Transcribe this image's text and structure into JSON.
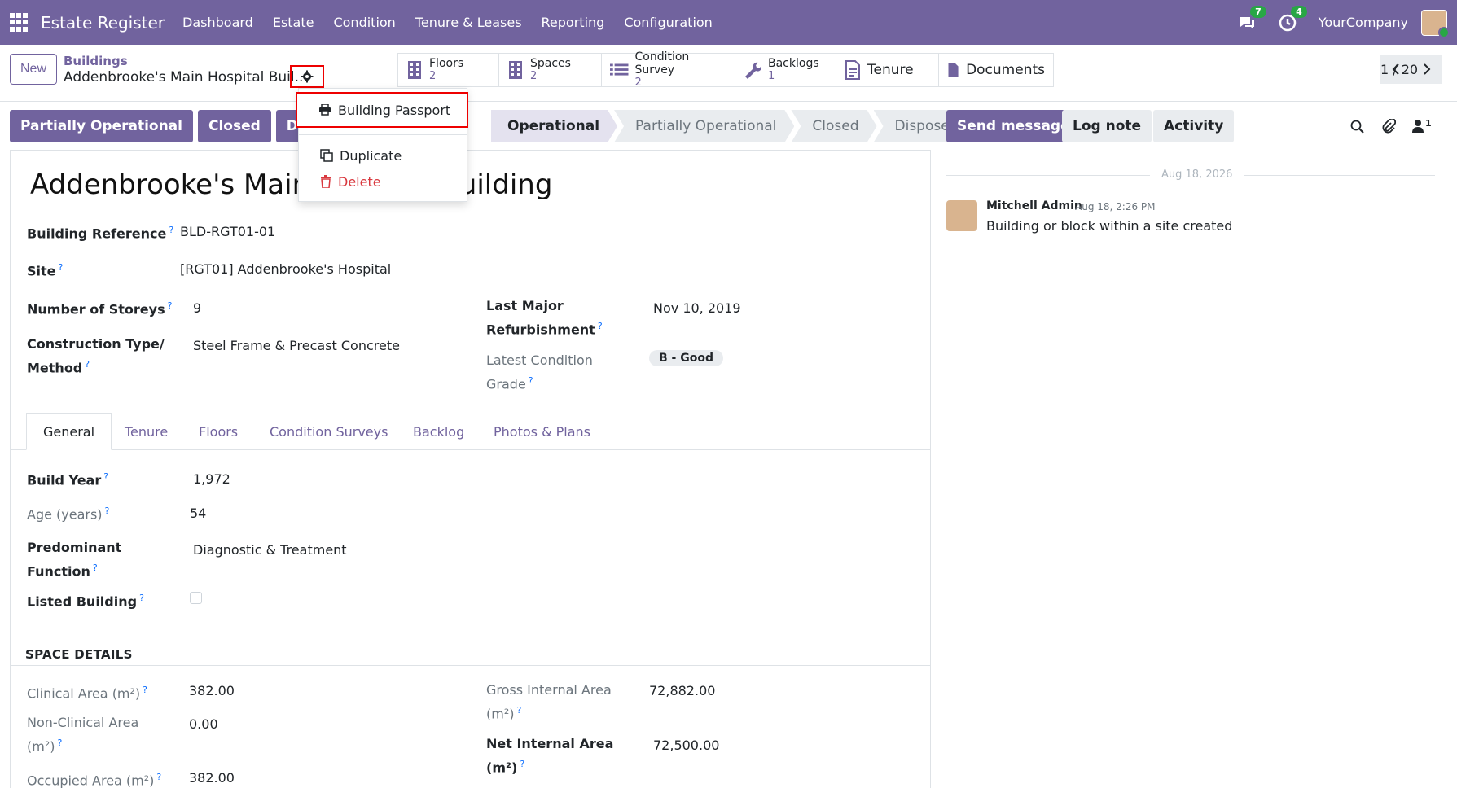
{
  "nav": {
    "brand": "Estate Register",
    "menu": [
      "Dashboard",
      "Estate",
      "Condition",
      "Tenure & Leases",
      "Reporting",
      "Configuration"
    ],
    "messages_badge": "7",
    "activities_badge": "4",
    "company": "YourCompany"
  },
  "control": {
    "new_label": "New",
    "breadcrumb_parent": "Buildings",
    "breadcrumb_current": "Addenbrooke's Main Hospital Buil...",
    "smart_buttons": [
      {
        "label": "Floors",
        "count": "2",
        "icon": "building-icon"
      },
      {
        "label": "Spaces",
        "count": "2",
        "icon": "building-icon"
      },
      {
        "label": "Condition Survey",
        "count": "2",
        "icon": "list-icon"
      },
      {
        "label": "Backlogs",
        "count": "1",
        "icon": "wrench-icon"
      },
      {
        "label": "Tenure",
        "icon": "document-icon"
      },
      {
        "label": "Documents",
        "icon": "file-icon"
      }
    ],
    "pager": "1 / 20"
  },
  "dropdown": {
    "passport": "Building Passport",
    "duplicate": "Duplicate",
    "delete": "Delete"
  },
  "statusbar": {
    "buttons": [
      "Partially Operational",
      "Closed",
      "Dispose"
    ],
    "stages": [
      "Operational",
      "Partially Operational",
      "Closed",
      "Disposed"
    ],
    "active_stage": "Operational"
  },
  "form": {
    "title": "Addenbrooke's Main Hospital Building",
    "building_reference_label": "Building Reference",
    "building_reference": "BLD-RGT01-01",
    "site_label": "Site",
    "site": "[RGT01] Addenbrooke's Hospital",
    "storeys_label": "Number of Storeys",
    "storeys": "9",
    "construction_label_1": "Construction Type/",
    "construction_label_2": "Method",
    "construction": "Steel Frame & Precast Concrete",
    "refurb_label_1": "Last Major",
    "refurb_label_2": "Refurbishment",
    "refurb": "Nov 10, 2019",
    "grade_label_1": "Latest Condition",
    "grade_label_2": "Grade",
    "grade": "B - Good",
    "tabs": [
      "General",
      "Tenure",
      "Floors",
      "Condition Surveys",
      "Backlog",
      "Photos & Plans"
    ],
    "build_year_label": "Build Year",
    "build_year": "1,972",
    "age_label": "Age (years)",
    "age": "54",
    "function_label_1": "Predominant",
    "function_label_2": "Function",
    "function": "Diagnostic & Treatment",
    "listed_label": "Listed Building",
    "space_details": "SPACE DETAILS",
    "clinical_label": "Clinical Area (m²)",
    "clinical": "382.00",
    "nonclinical_label_1": "Non-Clinical Area",
    "nonclinical_label_2": "(m²)",
    "nonclinical": "0.00",
    "occupied_label": "Occupied Area (m²)",
    "occupied": "382.00",
    "gia_label_1": "Gross Internal Area",
    "gia_label_2": "(m²)",
    "gia": "72,882.00",
    "nia_label_1": "Net Internal Area",
    "nia_label_2": "(m²)",
    "nia": "72,500.00"
  },
  "chatter": {
    "send_message": "Send message",
    "log_note": "Log note",
    "activity": "Activity",
    "followers": "1",
    "date": "Aug 18, 2026",
    "author": "Mitchell Admin",
    "time": "Aug 18, 2:26 PM",
    "body": "Building or block within a site created"
  },
  "colors": {
    "brand": "#71639e",
    "highlight": "#e00000"
  }
}
